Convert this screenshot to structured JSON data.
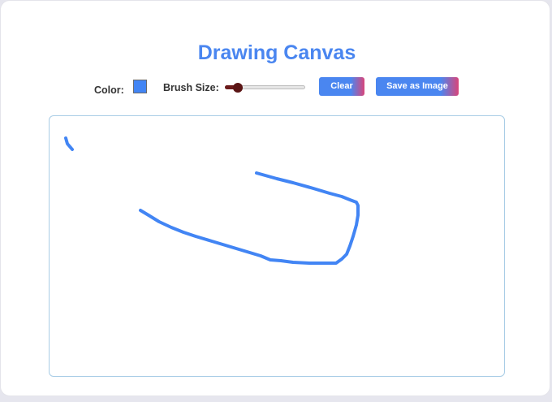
{
  "app": {
    "title": "Drawing Canvas"
  },
  "toolbar": {
    "color_label": "Color:",
    "color_value": "#4285f4",
    "brush_label": "Brush Size:",
    "brush_size_fraction": 0.12,
    "clear_label": "Clear",
    "save_label": "Save as Image"
  },
  "colors": {
    "accent": "#4a86f0",
    "gradient_end": "#d9457a",
    "stroke": "#4285f4",
    "slider_thumb": "#5a1414",
    "canvas_border": "#a9cde6"
  }
}
